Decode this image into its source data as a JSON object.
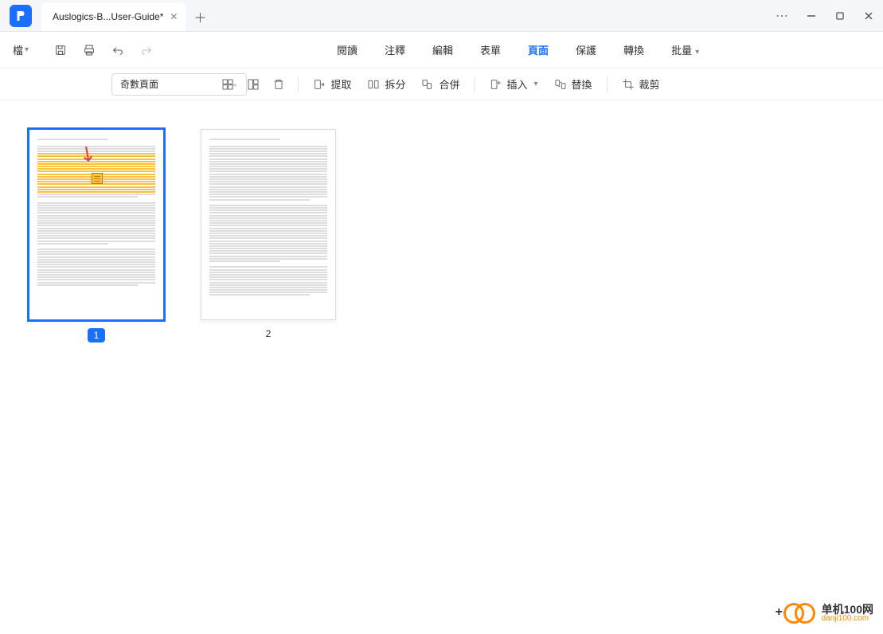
{
  "tab_title": "Auslogics-B...User-Guide*",
  "file_menu": "檔",
  "main_menu": {
    "read": "閱讀",
    "annotate": "注釋",
    "edit": "編輯",
    "form": "表單",
    "page": "頁面",
    "protect": "保護",
    "convert": "轉換",
    "batch": "批量"
  },
  "select_value": "奇數頁面",
  "tools": {
    "extract": "提取",
    "split": "拆分",
    "merge": "合併",
    "insert": "插入",
    "replace": "替換",
    "crop": "裁剪"
  },
  "pages": {
    "p1": "1",
    "p2": "2"
  },
  "watermark": {
    "name": "单机100网",
    "url": "danji100.com"
  }
}
